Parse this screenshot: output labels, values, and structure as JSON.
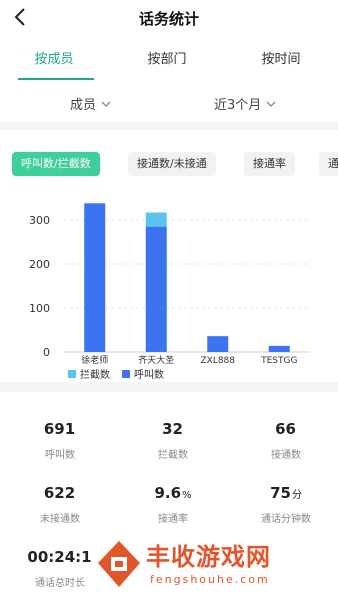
{
  "header": {
    "title": "话务统计",
    "back_icon": "chevron-left-icon"
  },
  "tabs": [
    {
      "label": "按成员",
      "active": true
    },
    {
      "label": "按部门",
      "active": false
    },
    {
      "label": "按时间",
      "active": false
    }
  ],
  "filters": {
    "member": {
      "label": "成员",
      "icon": "chevron-down-icon"
    },
    "range": {
      "label": "近3个月",
      "icon": "chevron-down-icon"
    }
  },
  "chips": [
    {
      "label": "呼叫数/拦截数",
      "active": true
    },
    {
      "label": "接通数/未接通",
      "active": false
    },
    {
      "label": "接通率",
      "active": false
    },
    {
      "label": "通",
      "active": false
    }
  ],
  "colors": {
    "accent": "#20a68a",
    "chip_active": "#3fcf9b",
    "call_bar": "#3b73f0",
    "intercept_bar": "#5bc3ec"
  },
  "chart_data": {
    "type": "bar",
    "stacked": true,
    "categories": [
      "徐老师",
      "齐天大圣",
      "ZXL888",
      "TESTGG"
    ],
    "series": [
      {
        "name": "呼叫数",
        "values": [
          338,
          285,
          36,
          14
        ]
      },
      {
        "name": "拦截数",
        "values": [
          0,
          32,
          0,
          0
        ]
      }
    ],
    "ylim": [
      0,
      350
    ],
    "yticks": [
      0,
      100,
      200,
      300
    ],
    "legend": [
      "拦截数",
      "呼叫数"
    ],
    "legend_position": "bottom-left",
    "grid": true
  },
  "stats": [
    {
      "value": "691",
      "unit": "",
      "label": "呼叫数"
    },
    {
      "value": "32",
      "unit": "",
      "label": "拦截数"
    },
    {
      "value": "66",
      "unit": "",
      "label": "接通数"
    },
    {
      "value": "622",
      "unit": "",
      "label": "未接通数"
    },
    {
      "value": "9.6",
      "unit": "%",
      "label": "接通率"
    },
    {
      "value": "75",
      "unit": "分",
      "label": "通话分钟数"
    },
    {
      "value": "00:24:1",
      "unit": "",
      "label": "通话总时长"
    }
  ],
  "watermark": {
    "text": "丰收游戏网",
    "url": "fengshouhe.com"
  }
}
